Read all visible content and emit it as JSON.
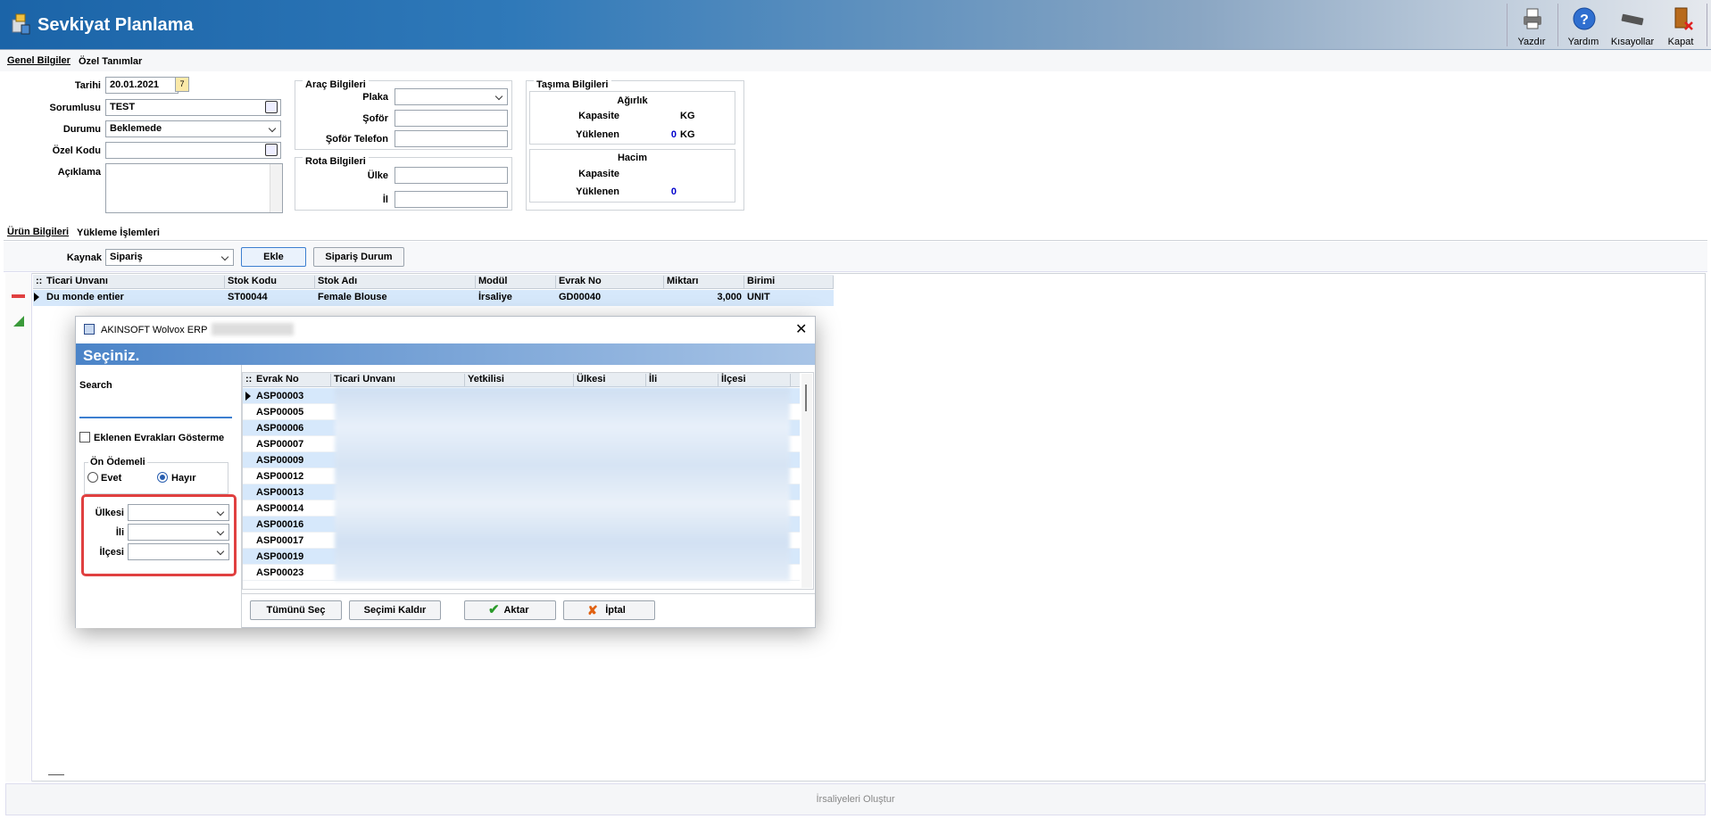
{
  "window": {
    "title": "Sevkiyat Planlama"
  },
  "toolbar": {
    "print": "Yazdır",
    "help": "Yardım",
    "shortcuts": "Kısayollar",
    "close": "Kapat"
  },
  "tabs_top": [
    "Genel Bilgiler",
    "Özel Tanımlar"
  ],
  "general": {
    "date_label": "Tarihi",
    "date_value": "20.01.2021",
    "responsible_label": "Sorumlusu",
    "responsible_value": "TEST",
    "status_label": "Durumu",
    "status_value": "Beklemede",
    "special_code_label": "Özel Kodu",
    "special_code_value": "",
    "description_label": "Açıklama"
  },
  "vehicle": {
    "title": "Araç Bilgileri",
    "plate_label": "Plaka",
    "driver_label": "Şoför",
    "driver_phone_label": "Şoför Telefon"
  },
  "route": {
    "title": "Rota Bilgileri",
    "country_label": "Ülke",
    "city_label": "İl"
  },
  "transport": {
    "title": "Taşıma Bilgileri",
    "weight": {
      "title": "Ağırlık",
      "capacity_label": "Kapasite",
      "capacity_unit": "KG",
      "loaded_label": "Yüklenen",
      "loaded_value": "0",
      "loaded_unit": "KG"
    },
    "volume": {
      "title": "Hacim",
      "capacity_label": "Kapasite",
      "loaded_label": "Yüklenen",
      "loaded_value": "0"
    }
  },
  "tabs_mid": [
    "Ürün Bilgileri",
    "Yükleme İşlemleri"
  ],
  "source": {
    "label": "Kaynak",
    "value": "Sipariş",
    "add_button": "Ekle",
    "order_status_button": "Sipariş Durum"
  },
  "grid": {
    "columns": [
      "Ticari Unvanı",
      "Stok Kodu",
      "Stok Adı",
      "Modül",
      "Evrak No",
      "Miktarı",
      "Birimi"
    ],
    "rows": [
      [
        "Du monde entier",
        "ST00044",
        "Female Blouse",
        "İrsaliye",
        "GD00040",
        "3,000",
        "UNIT"
      ]
    ]
  },
  "footer": {
    "create_button": "İrsaliyeleri Oluştur"
  },
  "dialog": {
    "app_title": "AKINSOFT Wolvox ERP",
    "heading": "Seçiniz.",
    "search_label": "Search",
    "search_value": "",
    "exclude_added_label": "Eklenen Evrakları Gösterme",
    "prepaid_label": "Ön Ödemeli",
    "yes_label": "Evet",
    "no_label": "Hayır",
    "prepaid_selected": "Hayır",
    "country_label": "Ülkesi",
    "city_label": "İli",
    "district_label": "İlçesi",
    "columns": [
      "Evrak No",
      "Ticari Unvanı",
      "Yetkilisi",
      "Ülkesi",
      "İli",
      "İlçesi"
    ],
    "doc_numbers": [
      "ASP00003",
      "ASP00005",
      "ASP00006",
      "ASP00007",
      "ASP00009",
      "ASP00012",
      "ASP00013",
      "ASP00014",
      "ASP00016",
      "ASP00017",
      "ASP00019",
      "ASP00023"
    ],
    "select_all_button": "Tümünü Seç",
    "clear_selection_button": "Seçimi Kaldır",
    "transfer_button": "Aktar",
    "cancel_button": "İptal"
  },
  "colors": {
    "title_blue": "#1b64a8",
    "highlight_red": "#e04040",
    "selection_blue": "#d6e8fb",
    "link_blue": "#0000cc"
  }
}
